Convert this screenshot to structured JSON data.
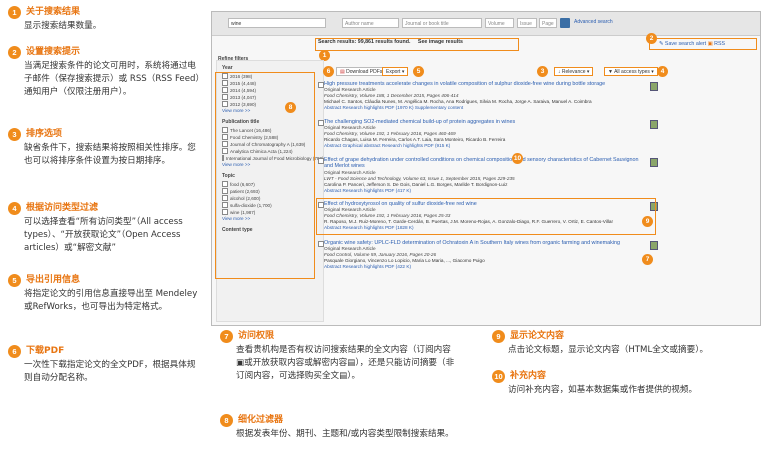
{
  "legend_left": [
    {
      "n": "1",
      "title": "关于搜索结果",
      "body": "显示搜索结果数量。"
    },
    {
      "n": "2",
      "title": "设置搜索提示",
      "body": "当满足搜索条件的论文可用时，系统将通过电子邮件（保存搜索提示）或 RSS（RSS Feed）通知用户（仅限注册用户）。"
    },
    {
      "n": "3",
      "title": "排序选项",
      "body": "缺省条件下，搜索结果将按照相关性排序。您也可以将排序条件设置为按日期排序。"
    },
    {
      "n": "4",
      "title": "根据访问类型过滤",
      "body": "可以选择查看“所有访问类型”（All access types）、“开放获取论文”（Open Access articles）或“解密文献”"
    },
    {
      "n": "5",
      "title": "导出引用信息",
      "body": "将指定论文的引用信息直接导出至 Mendeley或RefWorks，也可导出为特定格式。"
    },
    {
      "n": "6",
      "title": "下载PDF",
      "body": "一次性下载指定论文的全文PDF，根据具体规则自动分配名称。"
    }
  ],
  "legend_bottom": [
    {
      "n": "7",
      "title": "访问权限",
      "body": "查看贵机构是否有权访问搜索结果的全文内容（订阅内容▣或开放获取内容或解密内容▤），还是只能访问摘要（非订阅内容，可选择购买全文▤）。"
    },
    {
      "n": "8",
      "title": "细化过滤器",
      "body": "根据发表年份、期刊、主题和/或内容类型限制搜索结果。"
    },
    {
      "n": "9",
      "title": "显示论文内容",
      "body": "点击论文标题，显示论文内容（HTML全文或摘要）。"
    },
    {
      "n": "10",
      "title": "补充内容",
      "body": "访问补充内容，如基本数据集或作者提供的视频。"
    }
  ],
  "shot": {
    "search_value": "wine",
    "author_ph": "Author name",
    "journal_ph": "Journal or book title",
    "volume_ph": "Volume",
    "issue_ph": "Issue",
    "page_ph": "Page",
    "advanced": "Advanced search",
    "results_text": "Search results: 99,861 results found.",
    "image_results": "See image results",
    "save_alert": "Save search alert",
    "rss": "RSS",
    "refine": "Refine filters",
    "download": "Download PDFs",
    "export": "Export",
    "relevance": "Relevance",
    "access_types": "All access types",
    "year_head": "Year",
    "years": [
      "2016 (398)",
      "2015 (4,448)",
      "2014 (4,594)",
      "2013 (4,047)",
      "2012 (3,690)"
    ],
    "view_more": "View more >>",
    "pub_head": "Publication title",
    "pubs": [
      "The Lancet (16,486)",
      "Food Chemistry (2,588)",
      "Journal of Chromatography A (1,639)",
      "Analytica Chimica Acta (1,224)",
      "International Journal of Food Microbiology (780)"
    ],
    "topic_head": "Topic",
    "topics": [
      "food (6,607)",
      "patient (2,693)",
      "alcohol (2,600)",
      "sulfa-dioxide (1,700)",
      "wine (1,987)"
    ],
    "ctype_head": "Content type",
    "results": [
      {
        "title": "High pressure treatments accelerate changes in volatile composition of sulphur dioxide-free wine during bottle storage",
        "type": "Original Research Article",
        "src": "Food Chemistry, Volume 188, 1 December 2015, Pages 406-414",
        "au": "Michael C. Santos, Cláudia Nunes, M. Angélica M. Rocha, Ana Rodrigues, Silvia M. Rocha, Jorge A. Saraiva, Manuel A. Coimbra",
        "links": "Abstract  Research highlights  PDF (1970 K)  Supplementary content"
      },
      {
        "title": "The challenging SO2-mediated chemical build-up of protein aggregates in wines",
        "type": "Original Research Article",
        "src": "Food Chemistry, Volume 192, 1 February 2016, Pages 460-469",
        "au": "Ricardo Chagas, Luisa M. Ferreira, Carlos A.T. Laia, Sara Monteiro, Ricardo B. Ferreira",
        "links": "Abstract  Graphical abstract  Research highlights  PDF (915 K)"
      },
      {
        "title": "Effect of grape dehydration under controlled conditions on chemical composition and sensory characteristics of Cabernet Sauvignon and Merlot wines",
        "type": "Original Research Article",
        "src": "LWT - Food Science and Technology, Volume 63, Issue 1, September 2015, Pages 229-235",
        "au": "Carolina P. Panceri, Jefferson S. De Gois, Daniel L.G. Borges, Marilde T. Bordignon-Luiz",
        "links": "Abstract  Research highlights  PDF (417 K)"
      },
      {
        "title": "Effect of hydroxytyrosol on quality of sulfur dioxide-free red wine",
        "type": "Original Research Article",
        "src": "Food Chemistry, Volume 192, 1 February 2016, Pages 25-33",
        "au": "R. Raposo, M.J. Ruiz-Moreno, T. Garde-Cerdán, B. Puertas, J.M. Moreno-Rojas, A. Gonzalo-Diago, R.F. Guerrero, V. Ortiz, E. Cantos-Villar",
        "links": "Abstract  Research highlights  PDF (1828 K)"
      },
      {
        "title": "Organic wine safety: UPLC-FLD determination of Ochratoxin A in Southern Italy wines from organic farming and winemaking",
        "type": "Original Research Article",
        "src": "Food Control, Volume 59, January 2016, Pages 20-26",
        "au": "Pasquale Giorgiano, Vincenzo Lo Lopicio, Maria Lo Maria, ..., Giacomo Puigo",
        "links": "Abstract  Research highlights  PDF (422 K)"
      }
    ]
  },
  "colors": {
    "accent": "#f08c1c",
    "link": "#2a5db0"
  }
}
